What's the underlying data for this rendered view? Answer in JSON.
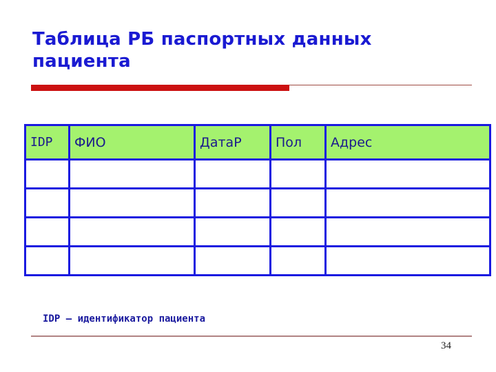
{
  "slide": {
    "title": "Таблица  РБ паспортных данных\nпациента",
    "page_number": "34",
    "footnote": "IDP – идентификатор пациента",
    "colors": {
      "title_blue": "#1a1ad2",
      "accent_red": "#cc1111",
      "rule_brown": "#9e4a42",
      "footer_rule": "#b08282",
      "table_border_blue": "#1a1ae0",
      "header_fill_green": "#a4f26e",
      "header_text_navy": "#1a1a8c"
    }
  },
  "table": {
    "columns": [
      {
        "key": "idp",
        "label": "IDP"
      },
      {
        "key": "fio",
        "label": "ФИО"
      },
      {
        "key": "datar",
        "label": "ДатаР"
      },
      {
        "key": "pol",
        "label": "Пол"
      },
      {
        "key": "adres",
        "label": "Адрес"
      }
    ],
    "rows": [
      {
        "idp": "",
        "fio": "",
        "datar": "",
        "pol": "",
        "adres": ""
      },
      {
        "idp": "",
        "fio": "",
        "datar": "",
        "pol": "",
        "adres": ""
      },
      {
        "idp": "",
        "fio": "",
        "datar": "",
        "pol": "",
        "adres": ""
      },
      {
        "idp": "",
        "fio": "",
        "datar": "",
        "pol": "",
        "adres": ""
      }
    ]
  }
}
